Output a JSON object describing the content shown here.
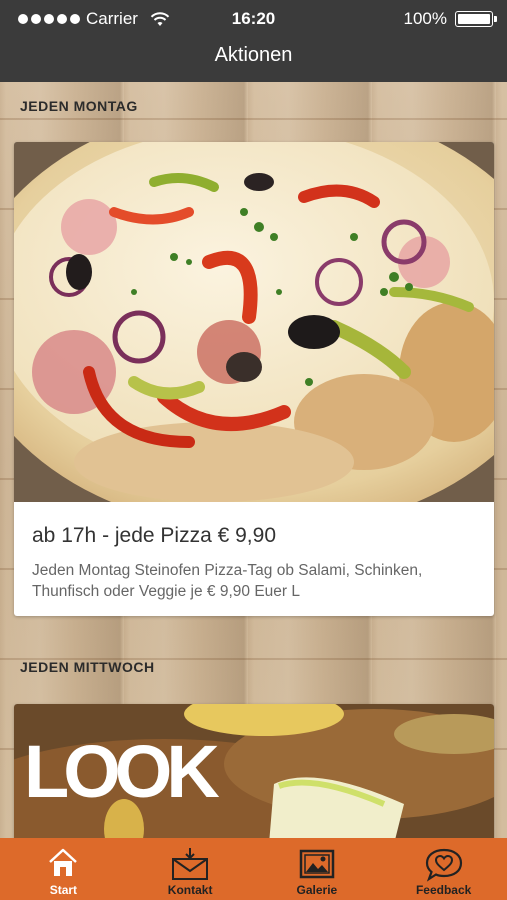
{
  "status": {
    "carrier": "Carrier",
    "time": "16:20",
    "battery": "100%"
  },
  "nav": {
    "title": "Aktionen"
  },
  "sections": [
    {
      "heading": "JEDEN MONTAG",
      "card": {
        "title": "ab 17h - jede Pizza € 9,90",
        "text": "Jeden Montag Steinofen Pizza-Tag ob Salami, Schinken, Thunfisch oder Veggie je € 9,90 Euer L"
      }
    },
    {
      "heading": "JEDEN MITTWOCH",
      "card": {
        "overlay_text": "LOOK"
      }
    }
  ],
  "tabs": [
    {
      "label": "Start",
      "icon": "home-icon",
      "active": true
    },
    {
      "label": "Kontakt",
      "icon": "envelope-icon",
      "active": false
    },
    {
      "label": "Galerie",
      "icon": "gallery-icon",
      "active": false
    },
    {
      "label": "Feedback",
      "icon": "heart-chat-icon",
      "active": false
    }
  ],
  "colors": {
    "header": "#3b3b3b",
    "tab_bar": "#dd6a2a",
    "active_tab": "#ffffff"
  }
}
